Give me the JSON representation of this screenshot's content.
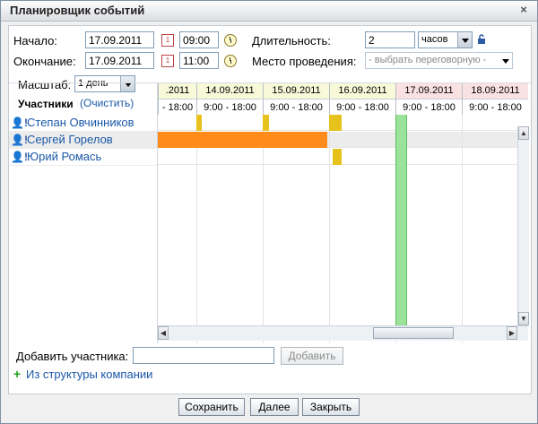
{
  "window": {
    "title": "Планировщик событий",
    "close_label": "×"
  },
  "form": {
    "start_label": "Начало:",
    "start_date": "17.09.2011",
    "start_time": "09:00",
    "end_label": "Окончание:",
    "end_date": "17.09.2011",
    "end_time": "11:00",
    "duration_label": "Длительность:",
    "duration_value": "2",
    "duration_unit": "часов",
    "location_label": "Место проведения:",
    "location_placeholder": "- выбрать переговорную -",
    "scale_label": "Масштаб:",
    "scale_value": "1 день"
  },
  "participants": {
    "header": "Участники",
    "clear_label": "(Очистить)",
    "items": [
      {
        "name": "Степан Овчинников"
      },
      {
        "name": "Сергей Горелов"
      },
      {
        "name": "Юрий Ромась"
      }
    ]
  },
  "timeline": {
    "days": [
      {
        "label": ".2011",
        "hours": "- 18:00",
        "weekend": false
      },
      {
        "label": "14.09.2011",
        "hours": "9:00 - 18:00",
        "weekend": false
      },
      {
        "label": "15.09.2011",
        "hours": "9:00 - 18:00",
        "weekend": false
      },
      {
        "label": "16.09.2011",
        "hours": "9:00 - 18:00",
        "weekend": false
      },
      {
        "label": "17.09.2011",
        "hours": "9:00 - 18:00",
        "weekend": true
      },
      {
        "label": "18.09.2011",
        "hours": "9:00 - 18:00",
        "weekend": true
      }
    ],
    "colors": {
      "workday_header": "#f7f9d9",
      "weekend_header": "#fbe2e2",
      "busy_orange": "#ff8c1a",
      "busy_yellow": "#e8c21c",
      "selection_green": "#9be39b"
    }
  },
  "add": {
    "label": "Добавить участника:",
    "input_value": "",
    "button": "Добавить",
    "structure_link": "Из структуры компании"
  },
  "buttons": {
    "save": "Сохранить",
    "next": "Далее",
    "close": "Закрыть"
  }
}
